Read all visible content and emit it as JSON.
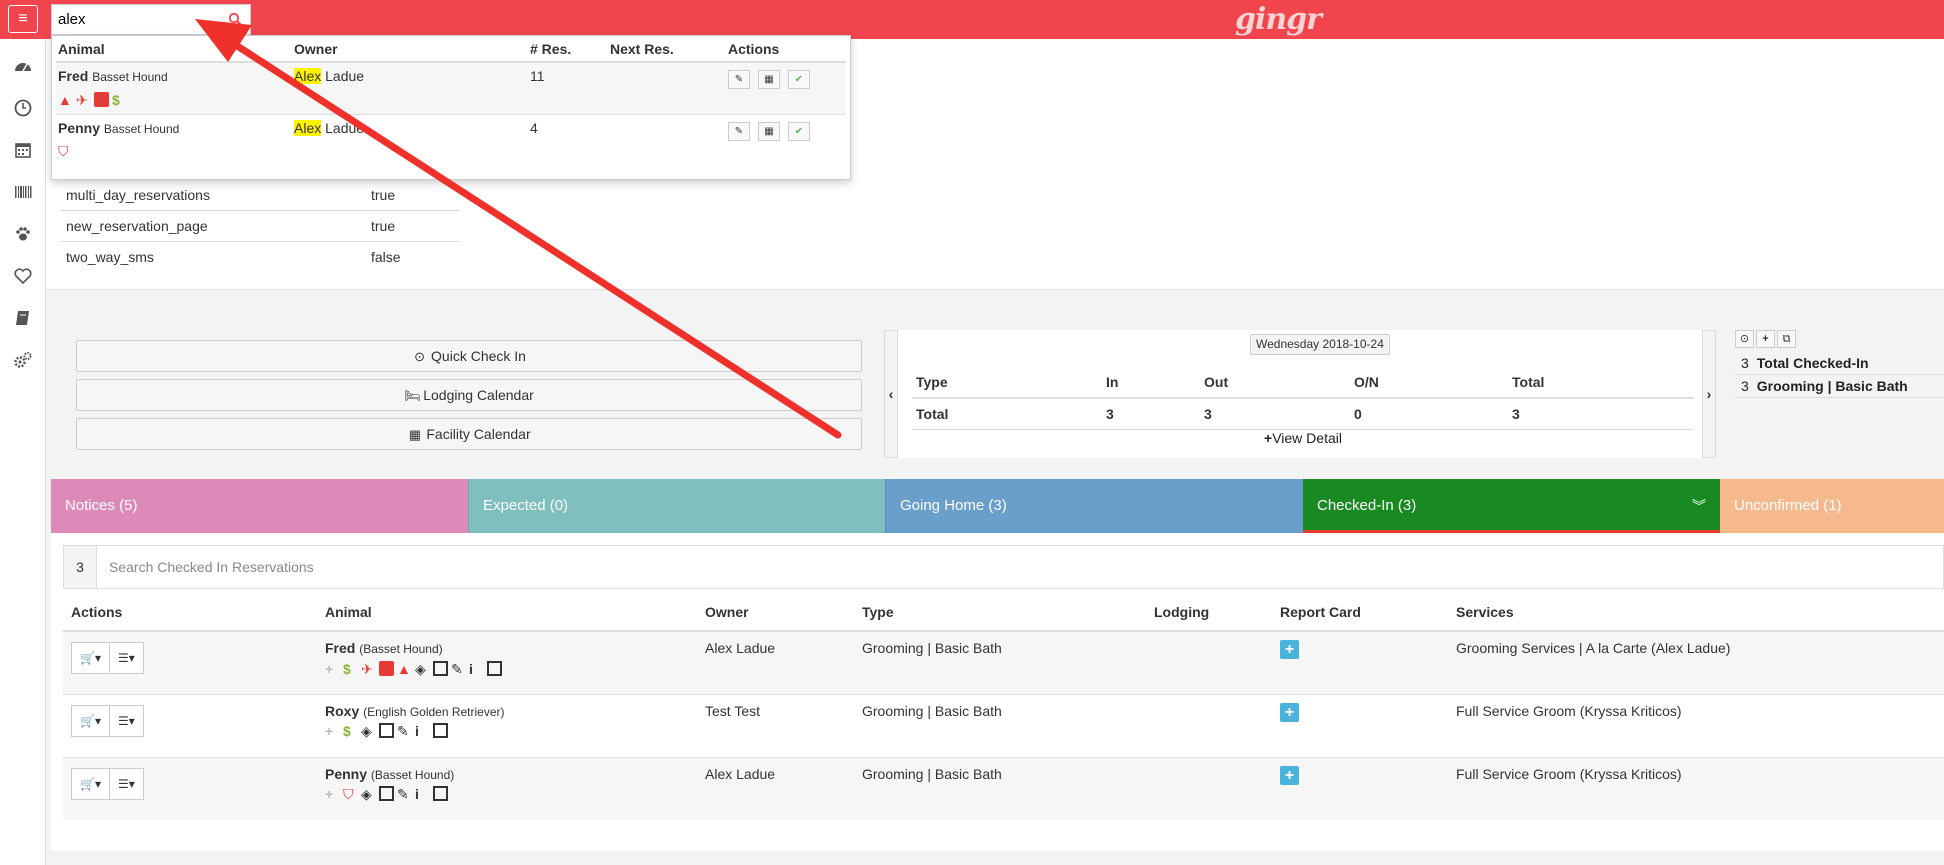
{
  "topbar": {
    "menu_icon": "hamburger-icon",
    "search_value": "alex",
    "logo_text": "gingr",
    "brand_color": "#f1454e"
  },
  "sidebar": {
    "items": [
      {
        "icon": "dashboard-icon"
      },
      {
        "icon": "clock-icon"
      },
      {
        "icon": "calendar-icon"
      },
      {
        "icon": "barcode-icon"
      },
      {
        "icon": "paw-icon"
      },
      {
        "icon": "heart-icon"
      },
      {
        "icon": "book-icon"
      },
      {
        "icon": "gears-icon"
      }
    ]
  },
  "search_results": {
    "headers": {
      "animal": "Animal",
      "owner": "Owner",
      "res": "# Res.",
      "next": "Next Res.",
      "actions": "Actions"
    },
    "rows": [
      {
        "name": "Fred",
        "breed": "Basset Hound",
        "owner_highlight": "Alex",
        "owner_rest": " Ladue",
        "res": "11",
        "next": ""
      },
      {
        "name": "Penny",
        "breed": "Basset Hound",
        "owner_highlight": "Alex",
        "owner_rest": " Ladue",
        "res": "4",
        "next": ""
      }
    ]
  },
  "feature_flags": [
    {
      "key": "multi_day_reservations",
      "value": "true"
    },
    {
      "key": "new_reservation_page",
      "value": "true"
    },
    {
      "key": "two_way_sms",
      "value": "false"
    }
  ],
  "quick_buttons": {
    "check_in": "Quick Check In",
    "lodging": "Lodging Calendar",
    "facility": "Facility Calendar"
  },
  "summary": {
    "date": "Wednesday 2018-10-24",
    "headers": {
      "type": "Type",
      "in": "In",
      "out": "Out",
      "on": "O/N",
      "total": "Total"
    },
    "row": {
      "type": "Total",
      "in": "3",
      "out": "3",
      "on": "0",
      "total": "3"
    },
    "view_detail": "View Detail"
  },
  "right_stats": [
    {
      "count": "3",
      "label": "Total Checked-In"
    },
    {
      "count": "3",
      "label": "Grooming | Basic Bath"
    }
  ],
  "tabs": [
    {
      "label": "Notices (5)",
      "color": "#de8ab8"
    },
    {
      "label": "Expected (0)",
      "color": "#7fbfbd"
    },
    {
      "label": "Going Home (3)",
      "color": "#6a9fcb"
    },
    {
      "label": "Checked-In (3)",
      "color": "#198a22"
    },
    {
      "label": "Unconfirmed (1)",
      "color": "#f5b98d"
    }
  ],
  "reservations": {
    "count": "3",
    "search_placeholder": "Search Checked In Reservations",
    "headers": {
      "actions": "Actions",
      "animal": "Animal",
      "owner": "Owner",
      "type": "Type",
      "lodging": "Lodging",
      "report_card": "Report Card",
      "services": "Services"
    },
    "rows": [
      {
        "name": "Fred",
        "breed": "(Basset Hound)",
        "owner": "Alex Ladue",
        "type": "Grooming | Basic Bath",
        "lodging": "",
        "services": "Grooming Services | A la Carte (Alex Ladue)"
      },
      {
        "name": "Roxy",
        "breed": "(English Golden Retriever)",
        "owner": "Test Test",
        "type": "Grooming | Basic Bath",
        "lodging": "",
        "services": "Full Service Groom (Kryssa Kriticos)"
      },
      {
        "name": "Penny",
        "breed": "(Basset Hound)",
        "owner": "Alex Ladue",
        "type": "Grooming | Basic Bath",
        "lodging": "",
        "services": "Full Service Groom (Kryssa Kriticos)"
      }
    ]
  },
  "annotation": {
    "arrow_color": "#f0302a"
  }
}
